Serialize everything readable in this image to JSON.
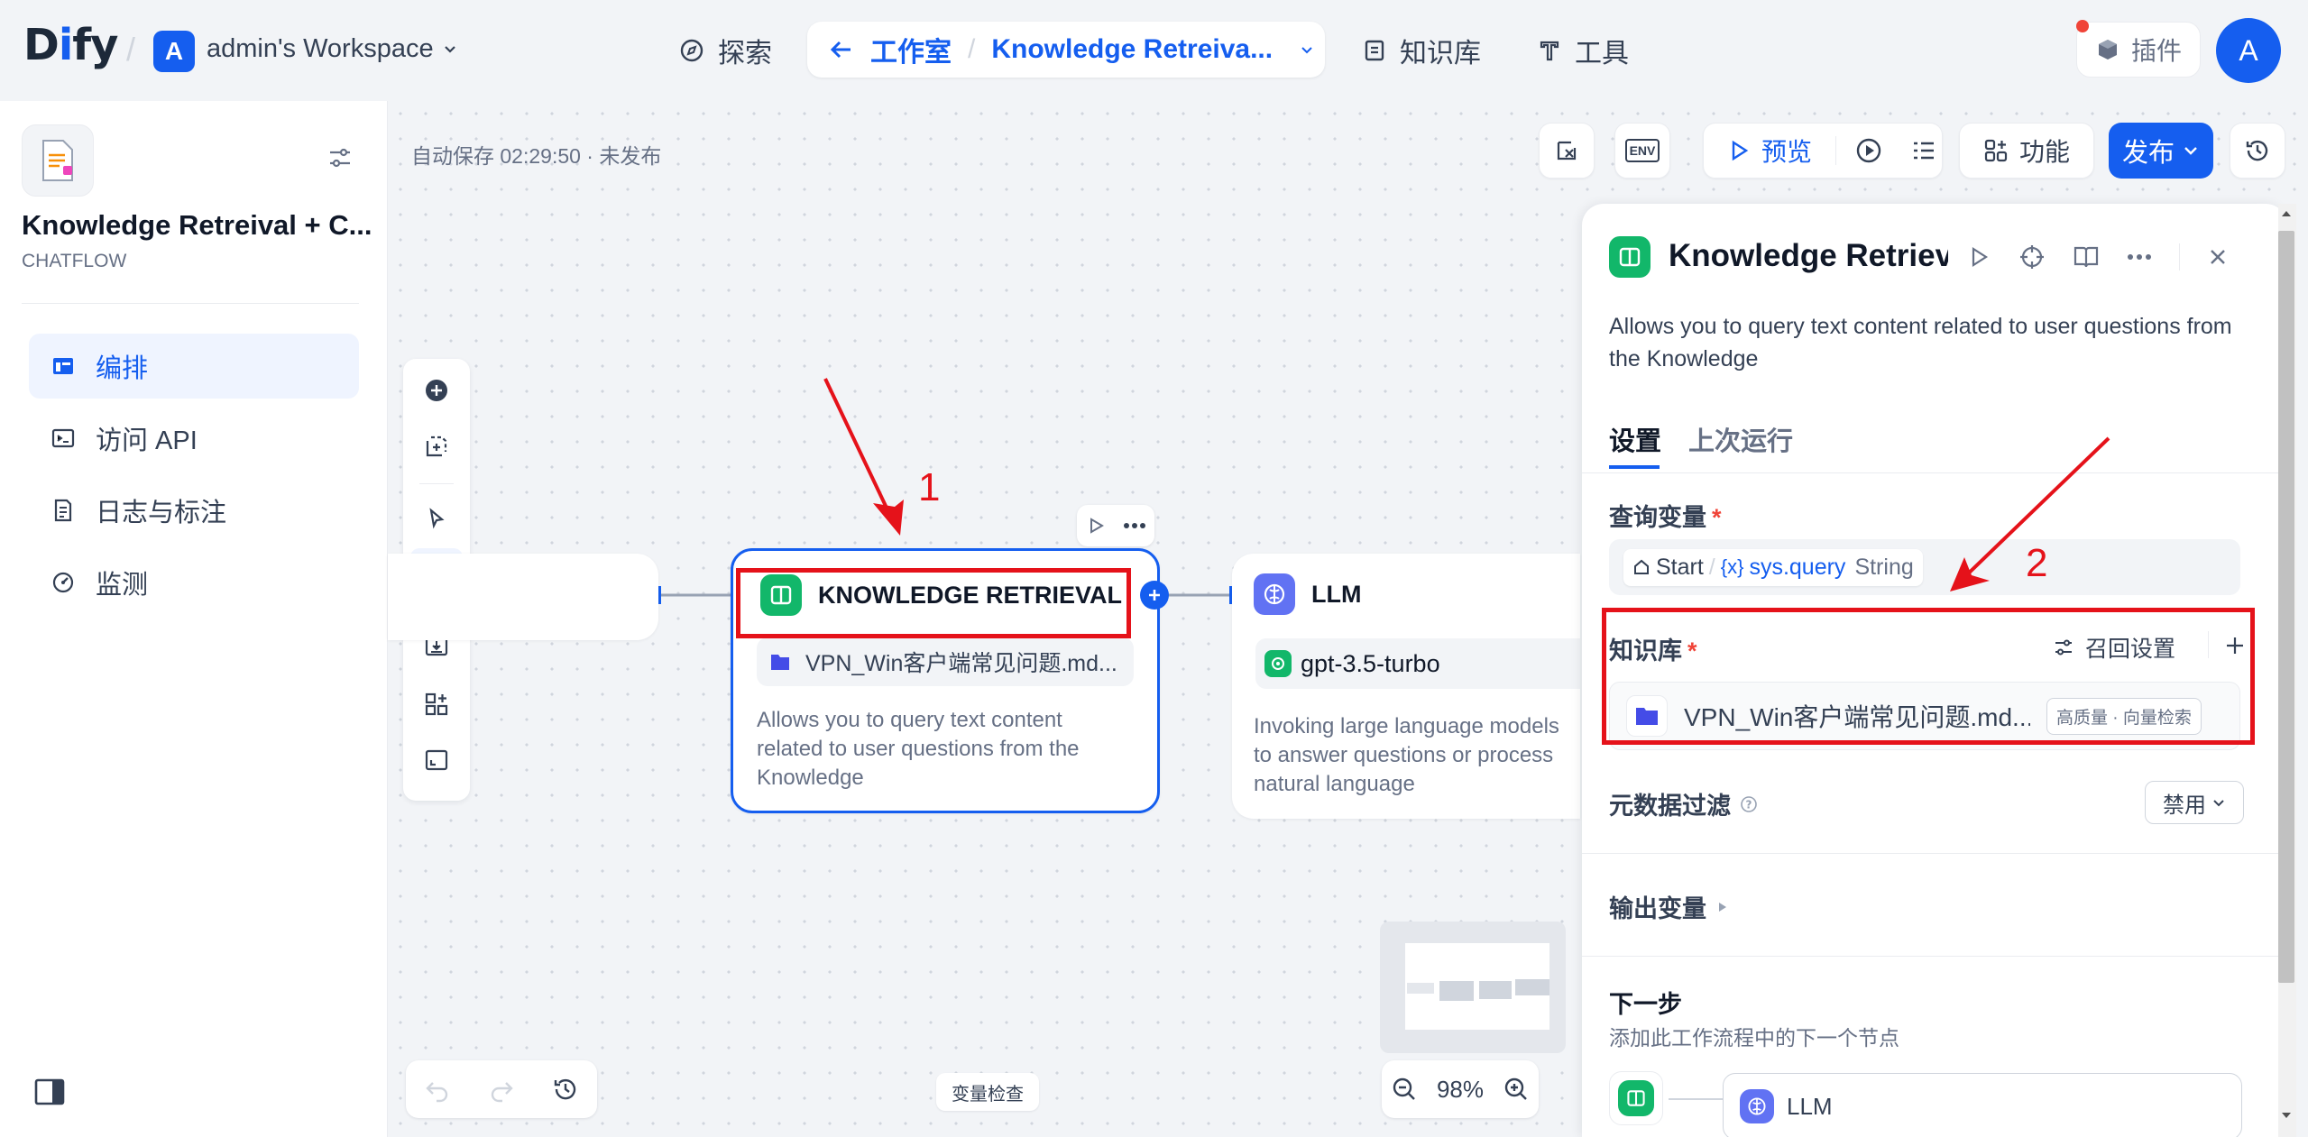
{
  "topbar": {
    "logo_main": "D",
    "logo_i": "i",
    "logo_rest": "fy",
    "workspace_initial": "A",
    "workspace_name": "admin's Workspace",
    "explore": "探索",
    "studio": "工作室",
    "current_app": "Knowledge Retreiva...",
    "knowledge": "知识库",
    "tools": "工具",
    "plugins": "插件",
    "user_initial": "A"
  },
  "sidebar": {
    "app_title": "Knowledge Retreival + C...",
    "app_type": "CHATFLOW",
    "items": [
      {
        "label": "编排"
      },
      {
        "label": "访问 API"
      },
      {
        "label": "日志与标注"
      },
      {
        "label": "监测"
      }
    ]
  },
  "toolbar": {
    "autosave": "自动保存 02:29:50 · 未发布",
    "env": "ENV",
    "preview": "预览",
    "features": "功能",
    "publish": "发布"
  },
  "nodes": {
    "kr": {
      "title": "KNOWLEDGE RETRIEVAL",
      "dataset": "VPN_Win客户端常见问题.md...",
      "desc": "Allows you to query text content related to user questions from the Knowledge"
    },
    "llm": {
      "title": "LLM",
      "model": "gpt-3.5-turbo",
      "desc": "Invoking large language models to answer questions or process natural language"
    }
  },
  "annotations": {
    "one": "1",
    "two": "2"
  },
  "panel": {
    "title": "Knowledge Retriev",
    "desc": "Allows you to query text content related to user questions from the Knowledge",
    "tabs": [
      "设置",
      "上次运行"
    ],
    "query_var_label": "查询变量",
    "query_start": "Start",
    "query_sep": "/",
    "query_var": "sys.query",
    "query_type": "String",
    "kb_label": "知识库",
    "recall_settings": "召回设置",
    "kb_item": "VPN_Win客户端常见问题.md...",
    "kb_badge": "高质量 · 向量检索",
    "metadata_label": "元数据过滤",
    "metadata_value": "禁用",
    "output_label": "输出变量",
    "next_label": "下一步",
    "next_desc": "添加此工作流程中的下一个节点",
    "next_node": "LLM"
  },
  "bottom": {
    "zoom": "98%",
    "var_check": "变量检查"
  },
  "colors": {
    "accent": "#155eef",
    "annotation_red": "#e5121a",
    "node_green": "#12b76a",
    "node_purple": "#6172f3"
  }
}
